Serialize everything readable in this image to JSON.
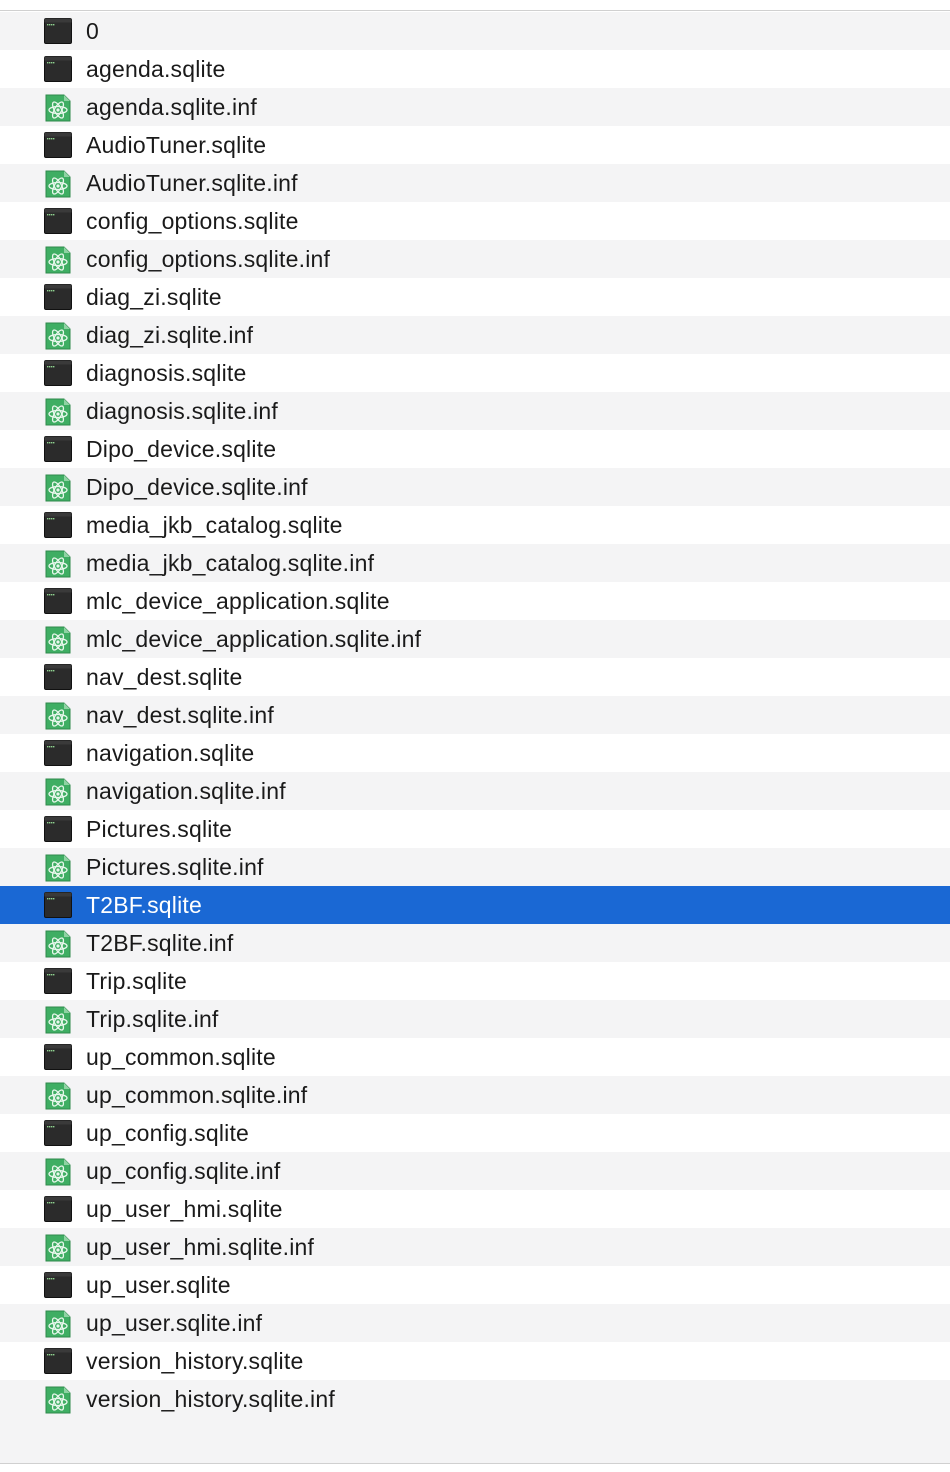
{
  "files": [
    {
      "name": "0",
      "icon": "exec-file-icon"
    },
    {
      "name": "agenda.sqlite",
      "icon": "exec-file-icon"
    },
    {
      "name": "agenda.sqlite.inf",
      "icon": "atom-file-icon"
    },
    {
      "name": "AudioTuner.sqlite",
      "icon": "exec-file-icon"
    },
    {
      "name": "AudioTuner.sqlite.inf",
      "icon": "atom-file-icon"
    },
    {
      "name": "config_options.sqlite",
      "icon": "exec-file-icon"
    },
    {
      "name": "config_options.sqlite.inf",
      "icon": "atom-file-icon"
    },
    {
      "name": "diag_zi.sqlite",
      "icon": "exec-file-icon"
    },
    {
      "name": "diag_zi.sqlite.inf",
      "icon": "atom-file-icon"
    },
    {
      "name": "diagnosis.sqlite",
      "icon": "exec-file-icon"
    },
    {
      "name": "diagnosis.sqlite.inf",
      "icon": "atom-file-icon"
    },
    {
      "name": "Dipo_device.sqlite",
      "icon": "exec-file-icon"
    },
    {
      "name": "Dipo_device.sqlite.inf",
      "icon": "atom-file-icon"
    },
    {
      "name": "media_jkb_catalog.sqlite",
      "icon": "exec-file-icon"
    },
    {
      "name": "media_jkb_catalog.sqlite.inf",
      "icon": "atom-file-icon"
    },
    {
      "name": "mlc_device_application.sqlite",
      "icon": "exec-file-icon"
    },
    {
      "name": "mlc_device_application.sqlite.inf",
      "icon": "atom-file-icon"
    },
    {
      "name": "nav_dest.sqlite",
      "icon": "exec-file-icon"
    },
    {
      "name": "nav_dest.sqlite.inf",
      "icon": "atom-file-icon"
    },
    {
      "name": "navigation.sqlite",
      "icon": "exec-file-icon"
    },
    {
      "name": "navigation.sqlite.inf",
      "icon": "atom-file-icon"
    },
    {
      "name": "Pictures.sqlite",
      "icon": "exec-file-icon"
    },
    {
      "name": "Pictures.sqlite.inf",
      "icon": "atom-file-icon"
    },
    {
      "name": "T2BF.sqlite",
      "icon": "exec-file-icon",
      "selected": true
    },
    {
      "name": "T2BF.sqlite.inf",
      "icon": "atom-file-icon"
    },
    {
      "name": "Trip.sqlite",
      "icon": "exec-file-icon"
    },
    {
      "name": "Trip.sqlite.inf",
      "icon": "atom-file-icon"
    },
    {
      "name": "up_common.sqlite",
      "icon": "exec-file-icon"
    },
    {
      "name": "up_common.sqlite.inf",
      "icon": "atom-file-icon"
    },
    {
      "name": "up_config.sqlite",
      "icon": "exec-file-icon"
    },
    {
      "name": "up_config.sqlite.inf",
      "icon": "atom-file-icon"
    },
    {
      "name": "up_user_hmi.sqlite",
      "icon": "exec-file-icon"
    },
    {
      "name": "up_user_hmi.sqlite.inf",
      "icon": "atom-file-icon"
    },
    {
      "name": "up_user.sqlite",
      "icon": "exec-file-icon"
    },
    {
      "name": "up_user.sqlite.inf",
      "icon": "atom-file-icon"
    },
    {
      "name": "version_history.sqlite",
      "icon": "exec-file-icon"
    },
    {
      "name": "version_history.sqlite.inf",
      "icon": "atom-file-icon"
    }
  ],
  "colors": {
    "selection": "#1a68d4",
    "stripe": "#f4f4f5",
    "atom_icon_green": "#3fae63",
    "exec_icon_dark": "#2b2b2b"
  }
}
